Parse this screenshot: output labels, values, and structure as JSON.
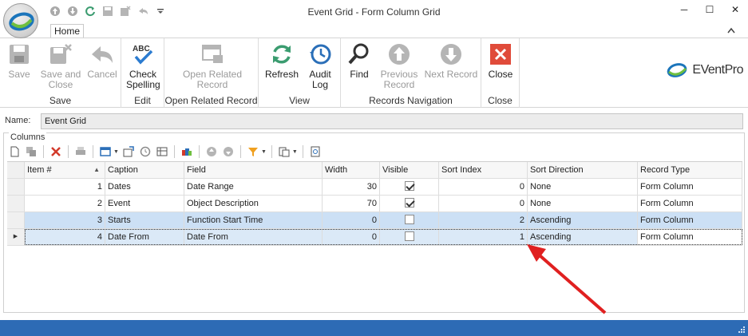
{
  "window": {
    "title": "Event Grid - Form Column Grid",
    "controls": {
      "minimize": "─",
      "maximize": "☐",
      "close": "✕"
    }
  },
  "ribbon": {
    "tab": "Home",
    "brand": {
      "name": "EVentPro",
      "colors": {
        "green": "#6fbf3f",
        "blue": "#1b75bb"
      }
    },
    "groups": [
      {
        "label": "Save",
        "buttons": [
          {
            "label": "Save",
            "icon": "save-icon",
            "enabled": false
          },
          {
            "label": "Save and Close",
            "icon": "save-close-icon",
            "enabled": false
          },
          {
            "label": "Cancel",
            "icon": "undo-icon",
            "enabled": false
          }
        ]
      },
      {
        "label": "Edit",
        "buttons": [
          {
            "label": "Check Spelling",
            "icon": "spellcheck-icon",
            "enabled": true
          }
        ]
      },
      {
        "label": "Open Related Record",
        "buttons": [
          {
            "label": "Open Related Record",
            "icon": "open-window-icon",
            "enabled": false
          }
        ]
      },
      {
        "label": "View",
        "buttons": [
          {
            "label": "Refresh",
            "icon": "refresh-icon",
            "enabled": true
          },
          {
            "label": "Audit Log",
            "icon": "audit-log-icon",
            "enabled": true
          }
        ]
      },
      {
        "label": "Records Navigation",
        "buttons": [
          {
            "label": "Find",
            "icon": "magnifier-icon",
            "enabled": true
          },
          {
            "label": "Previous Record",
            "icon": "arrow-up-icon",
            "enabled": false
          },
          {
            "label": "Next Record",
            "icon": "arrow-down-icon",
            "enabled": false
          }
        ]
      },
      {
        "label": "Close",
        "buttons": [
          {
            "label": "Close",
            "icon": "close-red-icon",
            "enabled": true
          }
        ]
      }
    ]
  },
  "form": {
    "name_label": "Name:",
    "name_value": "Event Grid"
  },
  "columns": {
    "legend": "Columns",
    "headers": [
      "Item #",
      "Caption",
      "Field",
      "Width",
      "Visible",
      "Sort Index",
      "Sort Direction",
      "Record Type"
    ],
    "rows": [
      {
        "item": "1",
        "caption": "Dates",
        "field": "Date Range",
        "width": "30",
        "visible": true,
        "sort_index": "0",
        "sort_direction": "None",
        "record_type": "Form Column"
      },
      {
        "item": "2",
        "caption": "Event",
        "field": "Object Description",
        "width": "70",
        "visible": true,
        "sort_index": "0",
        "sort_direction": "None",
        "record_type": "Form Column"
      },
      {
        "item": "3",
        "caption": "Starts",
        "field": "Function Start Time",
        "width": "0",
        "visible": false,
        "sort_index": "2",
        "sort_direction": "Ascending",
        "record_type": "Form Column"
      },
      {
        "item": "4",
        "caption": "Date From",
        "field": "Date From",
        "width": "0",
        "visible": false,
        "sort_index": "1",
        "sort_direction": "Ascending",
        "record_type": "Form Column"
      }
    ],
    "selected_row": 3,
    "focused_row": 4
  },
  "colors": {
    "status_bar": "#2d6bb5",
    "selection": "#cce0f5",
    "annotation_arrow": "#e02020"
  }
}
